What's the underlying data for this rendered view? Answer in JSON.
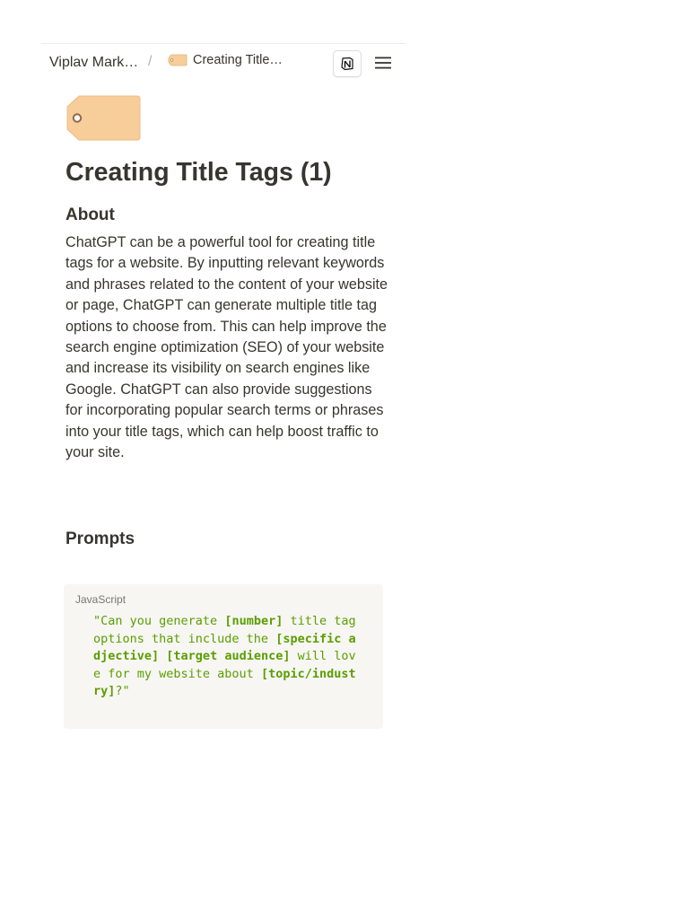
{
  "breadcrumb": {
    "workspace": "Viplav Mark…",
    "separator": "/",
    "page": "Creating Title…"
  },
  "icons": {
    "page_icon": "price-tag-icon",
    "notion": "notion-logo-icon",
    "menu": "hamburger-menu-icon"
  },
  "colors": {
    "tag_fill": "#f7cd9a",
    "code_bg": "#f7f6f3",
    "code_text": "#5a9e00",
    "text": "#37352f"
  },
  "page": {
    "title": "Creating Title Tags (1)",
    "about_heading": "About",
    "about_text": "ChatGPT can be a powerful tool for creating title tags for a website. By inputting relevant keywords and phrases related to the content of your website or page, ChatGPT can generate multiple title tag options to choose from. This can help improve the search engine optimization (SEO) of your website and increase its visibility on search engines like Google. ChatGPT can also provide suggestions for incorporating popular search terms or phrases into your title tags, which can help boost traffic to your site.",
    "prompts_heading": "Prompts"
  },
  "code_block": {
    "language": "JavaScript",
    "lines": [
      {
        "segments": [
          {
            "text": "\"Can you generate ",
            "bold": false
          },
          {
            "text": "[number]",
            "bold": true
          },
          {
            "text": " title tag",
            "bold": false
          }
        ]
      },
      {
        "segments": [
          {
            "text": "options that include the ",
            "bold": false
          },
          {
            "text": "[specific a",
            "bold": true
          }
        ]
      },
      {
        "segments": [
          {
            "text": "djective]",
            "bold": true
          },
          {
            "text": " ",
            "bold": false
          },
          {
            "text": "[target audience]",
            "bold": true
          },
          {
            "text": " will lov",
            "bold": false
          }
        ]
      },
      {
        "segments": [
          {
            "text": "e for my website about ",
            "bold": false
          },
          {
            "text": "[topic/indust",
            "bold": true
          }
        ]
      },
      {
        "segments": [
          {
            "text": "ry]",
            "bold": true
          },
          {
            "text": "?\"",
            "bold": false
          }
        ]
      }
    ]
  }
}
